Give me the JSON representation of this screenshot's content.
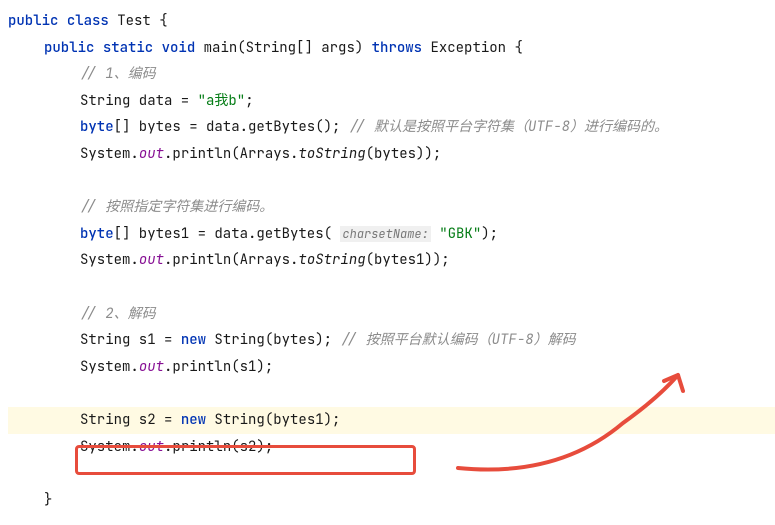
{
  "code": {
    "line1": {
      "public": "public",
      "class": "class",
      "name": "Test",
      "brace": " {"
    },
    "line2": {
      "public": "public",
      "static": "static",
      "void": "void",
      "main": "main(",
      "stringArr": "String[]",
      "args": " args) ",
      "throws": "throws",
      "exception": " Exception {"
    },
    "line3": "// 1、编码",
    "line4": {
      "type": "String",
      "var": " data = ",
      "str": "\"a我b\"",
      "semi": ";"
    },
    "line5": {
      "type": "byte",
      "arr": "[] bytes = data.getBytes(); ",
      "comment": "// 默认是按照平台字符集（UTF-8）进行编码的。"
    },
    "line6": {
      "sys": "System.",
      "out": "out",
      "dot": ".println(Arrays.",
      "tostr": "toString",
      "end": "(bytes));"
    },
    "line7": "// 按照指定字符集进行编码。",
    "line8": {
      "type": "byte",
      "arr": "[] bytes1 = data.getBytes( ",
      "hint": "charsetName:",
      "sp": " ",
      "str": "\"GBK\"",
      "end": ");"
    },
    "line9": {
      "sys": "System.",
      "out": "out",
      "dot": ".println(Arrays.",
      "tostr": "toString",
      "end": "(bytes1));"
    },
    "line10": "// 2、解码",
    "line11": {
      "type": "String",
      "var": " s1 = ",
      "new": "new",
      "rest": " String(bytes); ",
      "comment": "// 按照平台默认编码（UTF-8）解码"
    },
    "line12": {
      "sys": "System.",
      "out": "out",
      "end": ".println(s1);"
    },
    "line13": {
      "type": "String",
      "var": " s2 = ",
      "new": "new",
      "rest": " String(bytes1);"
    },
    "line14": {
      "sys": "System.",
      "out": "out",
      "end": ".println(s2);"
    },
    "closeBrace": "}"
  }
}
